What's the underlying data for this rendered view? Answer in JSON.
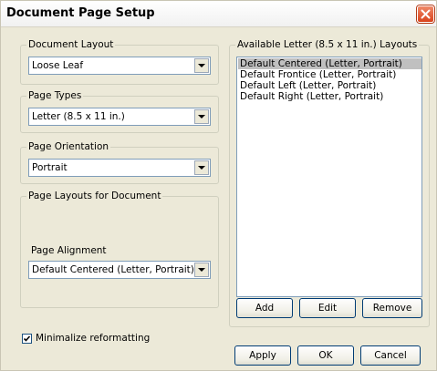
{
  "window": {
    "title": "Document Page Setup"
  },
  "document_layout": {
    "legend": "Document Layout",
    "selected": "Loose Leaf"
  },
  "page_types": {
    "legend": "Page Types",
    "selected": "Letter (8.5 x 11 in.)"
  },
  "page_orientation": {
    "legend": "Page Orientation",
    "selected": "Portrait"
  },
  "page_layouts": {
    "legend": "Page Layouts for Document",
    "alignment_label": "Page Alignment",
    "alignment_selected": "Default Centered (Letter, Portrait)"
  },
  "available_layouts": {
    "legend": "Available Letter (8.5 x 11 in.) Layouts",
    "items": [
      "Default Centered (Letter, Portrait)",
      "Default Frontice (Letter, Portrait)",
      "Default Left (Letter, Portrait)",
      "Default Right (Letter, Portrait)"
    ],
    "selected_index": 0,
    "add_label": "Add",
    "edit_label": "Edit",
    "remove_label": "Remove"
  },
  "options": {
    "minimize_reformatting_label": "Minimalize reformatting",
    "minimize_reformatting_checked": true
  },
  "footer": {
    "apply_label": "Apply",
    "ok_label": "OK",
    "cancel_label": "Cancel"
  }
}
